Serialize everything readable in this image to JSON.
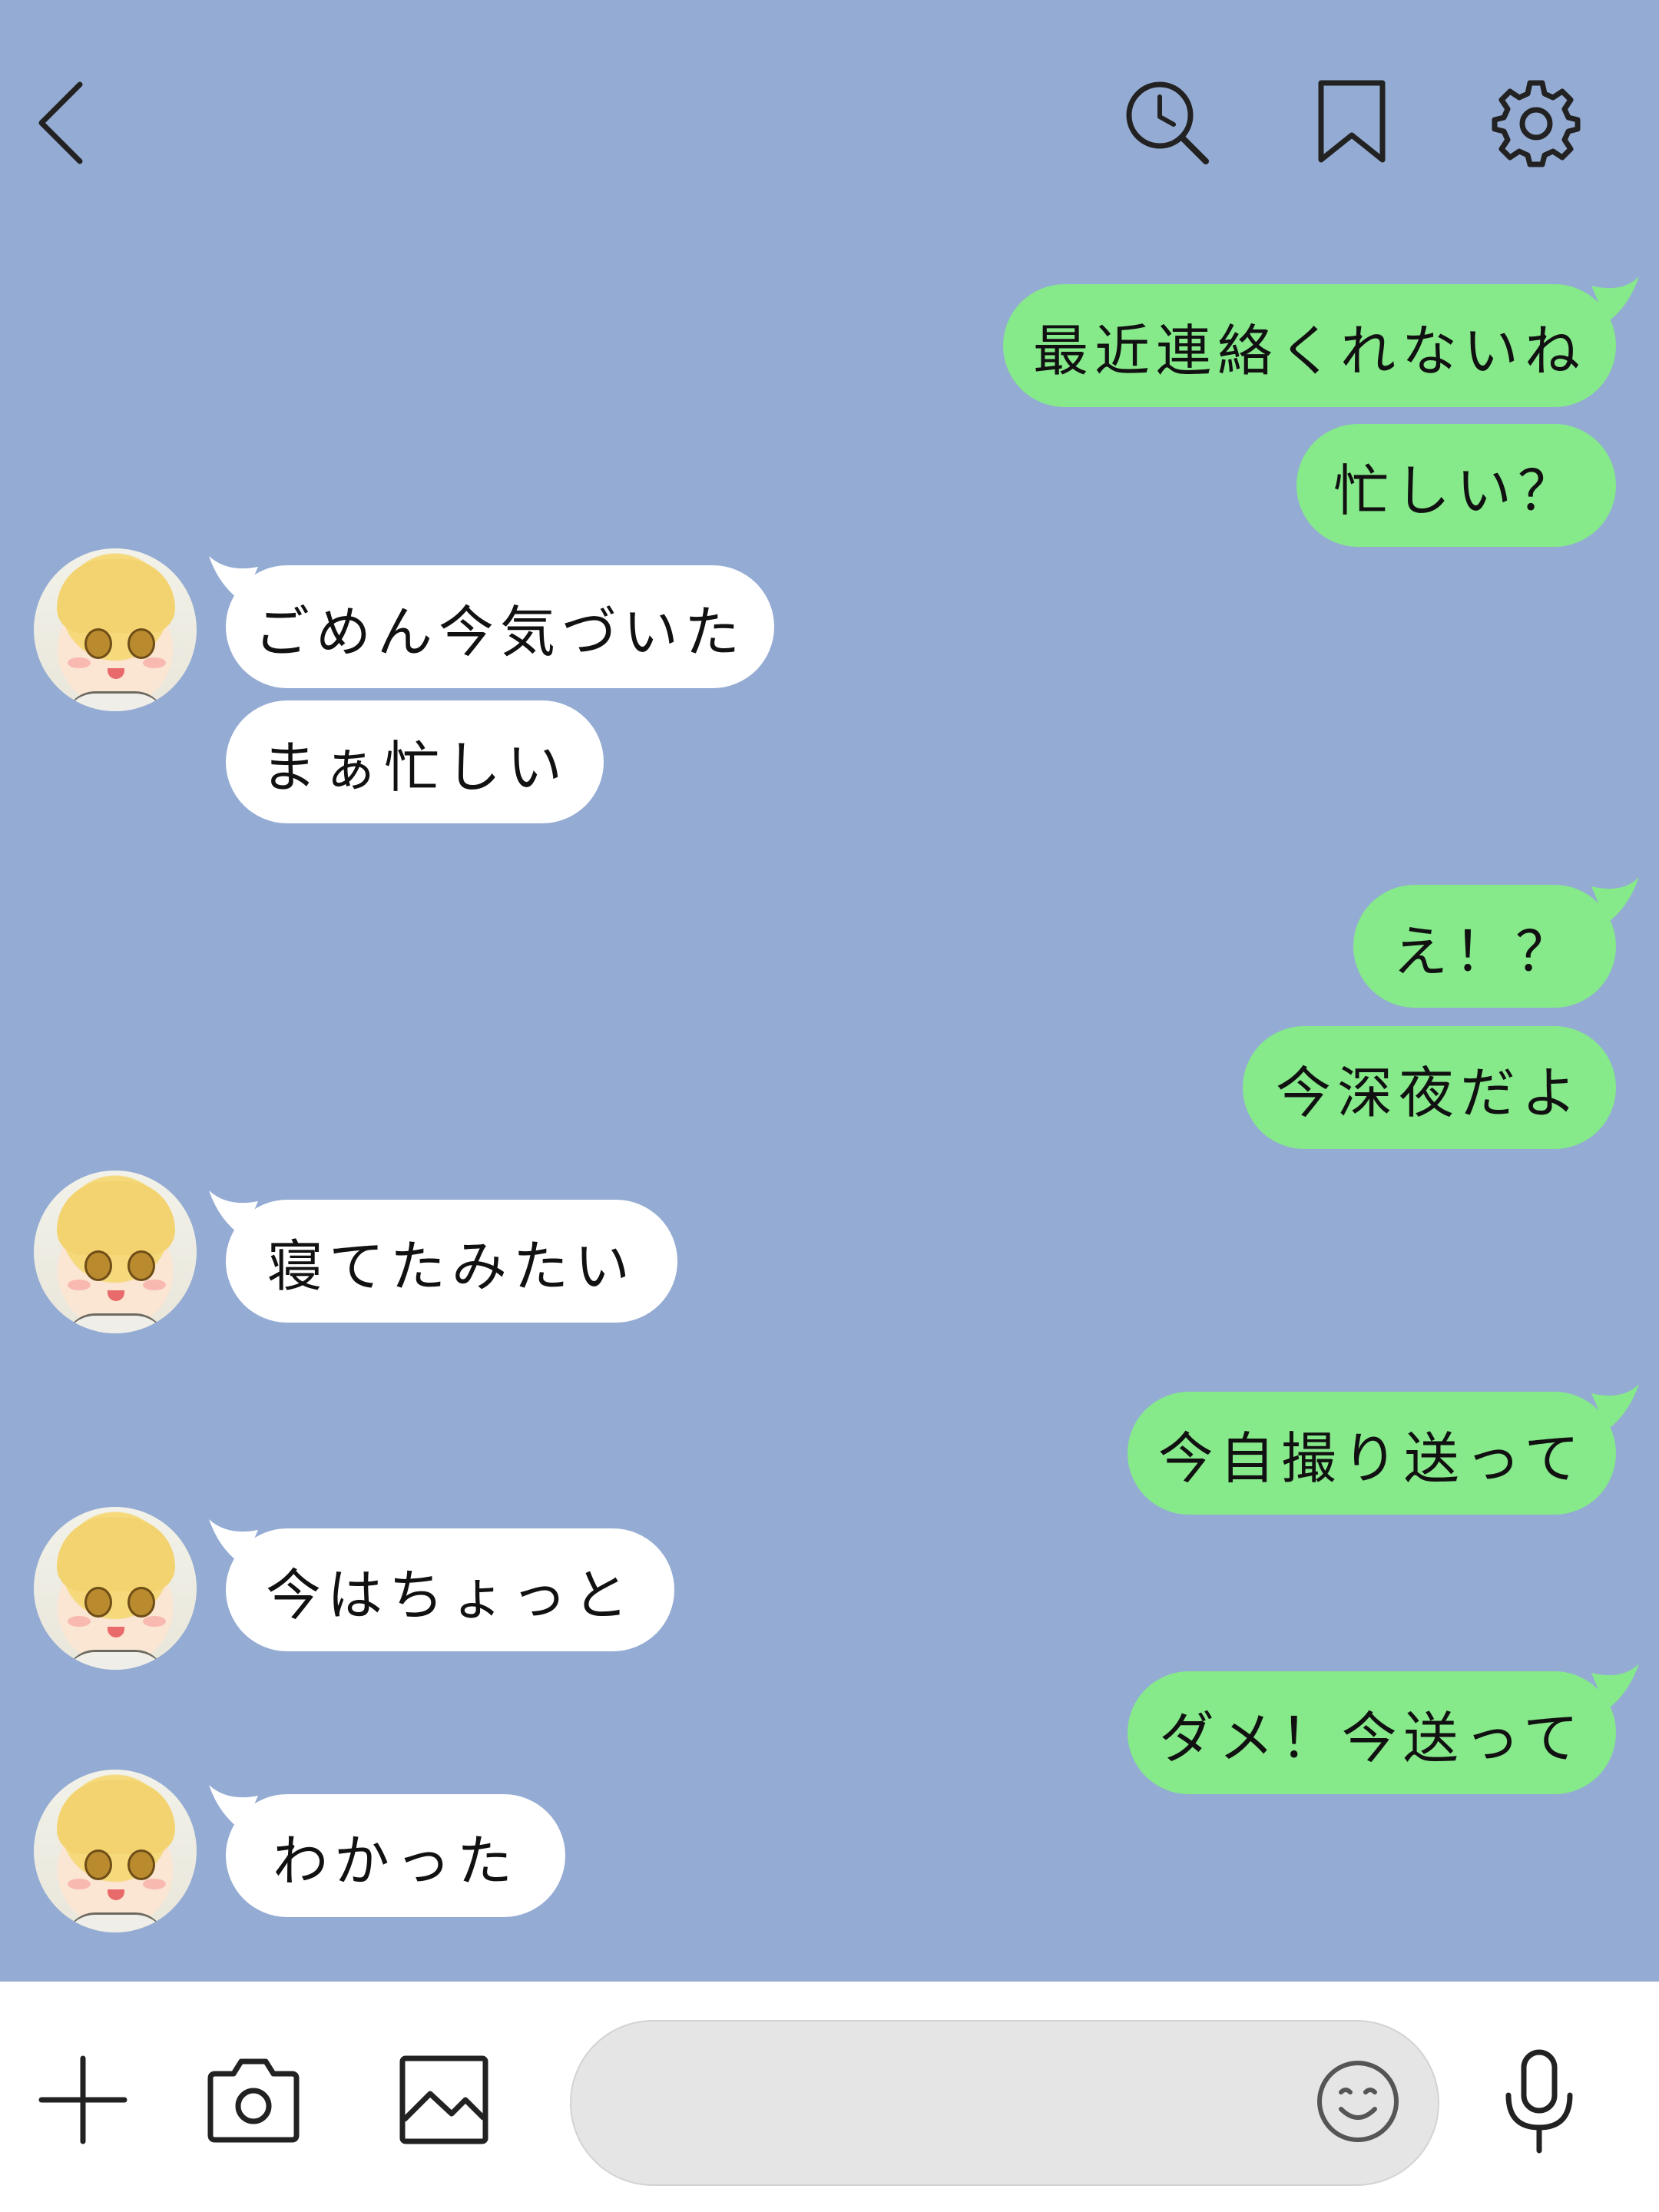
{
  "header": {
    "back_icon": "chevron-left-icon",
    "search_icon": "search-history-icon",
    "bookmark_icon": "bookmark-icon",
    "settings_icon": "gear-icon"
  },
  "messages": [
    {
      "sender": "me",
      "text": "最近連絡くれないね"
    },
    {
      "sender": "me",
      "text": "忙しい？"
    },
    {
      "sender": "them",
      "text": "ごめん今気づいた"
    },
    {
      "sender": "them",
      "text": "まぁ忙しい"
    },
    {
      "sender": "me",
      "text": "え！？"
    },
    {
      "sender": "me",
      "text": "今深夜だよ"
    },
    {
      "sender": "them",
      "text": "寝てたみたい"
    },
    {
      "sender": "me",
      "text": "今自撮り送って"
    },
    {
      "sender": "them",
      "text": "今はちょっと"
    },
    {
      "sender": "me",
      "text": "ダメ！今送って"
    },
    {
      "sender": "them",
      "text": "わかった"
    }
  ],
  "composer": {
    "plus_icon": "plus-icon",
    "camera_icon": "camera-icon",
    "image_icon": "image-icon",
    "emoji_icon": "smiley-icon",
    "mic_icon": "microphone-icon",
    "input_value": ""
  },
  "colors": {
    "background": "#94abd3",
    "my_bubble": "#86e98a",
    "their_bubble": "#ffffff"
  }
}
